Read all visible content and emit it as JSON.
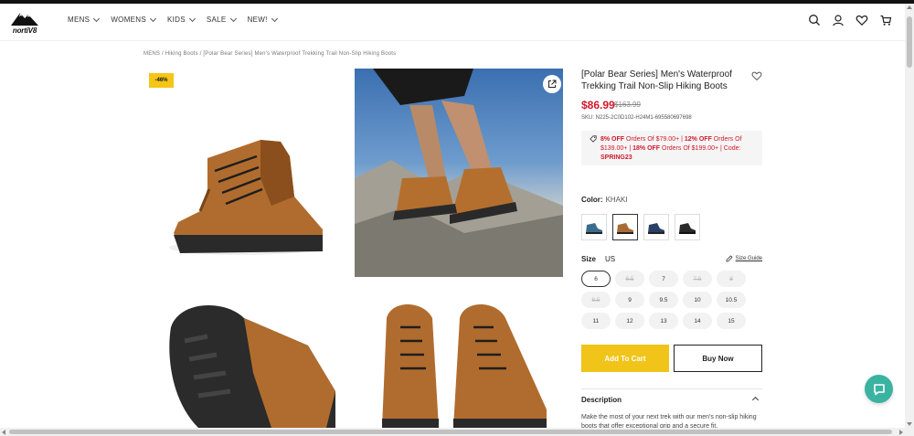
{
  "brand": {
    "logo_text": "nortiV8"
  },
  "nav": {
    "items": [
      {
        "label": "MENS"
      },
      {
        "label": "WOMENS"
      },
      {
        "label": "KIDS"
      },
      {
        "label": "SALE"
      },
      {
        "label": "NEW!"
      }
    ]
  },
  "header_icons": [
    "search-icon",
    "account-icon",
    "wishlist-icon",
    "cart-icon"
  ],
  "breadcrumb": "MENS / Hiking Boots / [Polar Bear Series] Men's Waterproof Trekking Trail Non-Slip Hiking Boots",
  "gallery": {
    "discount_badge": "-46%"
  },
  "product": {
    "title": "[Polar Bear Series] Men's Waterproof Trekking Trail Non-Slip Hiking Boots",
    "price": "$86.99",
    "old_price": "$163.99",
    "sku": "SKU: N225-2C0D102-H24M1-695580697698",
    "promo": {
      "p1_bold": "8% OFF",
      "p1_text": " Orders Of $79.00+ | ",
      "p2_bold": "12% OFF",
      "p2_text": " Orders Of $139.00+ | ",
      "p3_bold": "18% OFF",
      "p3_text": " Orders Of $199.00+ | Code: ",
      "code": "SPRING23"
    },
    "color_label": "Color:",
    "color_value": "KHAKI",
    "swatches": [
      {
        "name": "blue-teal",
        "color": "#3a6d8c"
      },
      {
        "name": "khaki",
        "color": "#a86b35"
      },
      {
        "name": "navy",
        "color": "#2b3e63"
      },
      {
        "name": "black",
        "color": "#2a2a2a"
      }
    ],
    "size_label": "Size",
    "size_unit": "US",
    "size_guide": "Size Guide",
    "sizes": [
      {
        "label": "6",
        "state": "selected"
      },
      {
        "label": "6.5",
        "state": "unavailable"
      },
      {
        "label": "7",
        "state": "available"
      },
      {
        "label": "7.5",
        "state": "unavailable"
      },
      {
        "label": "8",
        "state": "unavailable"
      },
      {
        "label": "8.5",
        "state": "unavailable"
      },
      {
        "label": "9",
        "state": "available"
      },
      {
        "label": "9.5",
        "state": "available"
      },
      {
        "label": "10",
        "state": "available"
      },
      {
        "label": "10.5",
        "state": "available"
      },
      {
        "label": "11",
        "state": "available"
      },
      {
        "label": "12",
        "state": "available"
      },
      {
        "label": "13",
        "state": "available"
      },
      {
        "label": "14",
        "state": "available"
      },
      {
        "label": "15",
        "state": "available"
      }
    ],
    "add_to_cart": "Add To Cart",
    "buy_now": "Buy Now",
    "description_heading": "Description",
    "description_text": "Make the most of your next trek with our men's non-slip hiking boots that offer exceptional grip and a secure fit."
  },
  "colors": {
    "sale_red": "#d2182b",
    "accent_yellow": "#f0c419",
    "chat_teal": "#3bb3a1"
  }
}
